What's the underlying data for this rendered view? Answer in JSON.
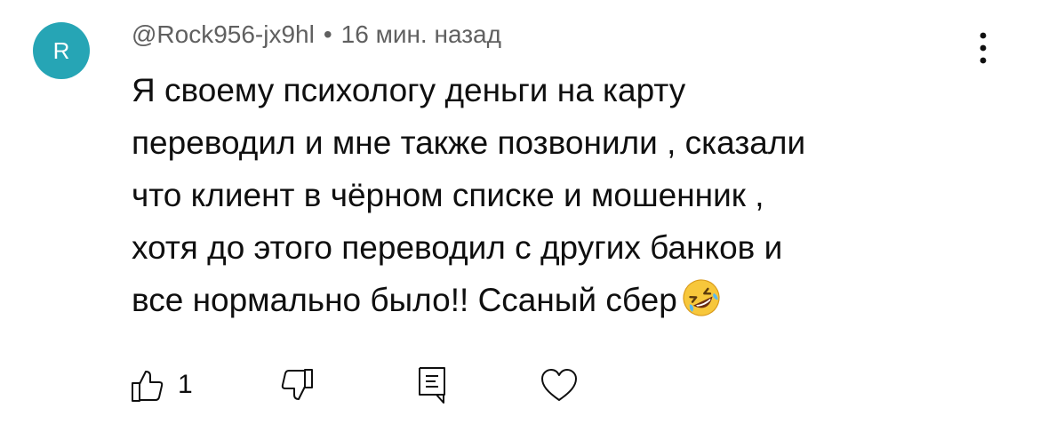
{
  "comment": {
    "avatar_letter": "R",
    "avatar_color": "#26a5b5",
    "author": "@Rock956-jx9hl",
    "separator": "•",
    "time": "16 мин. назад",
    "body": "Я своему психологу деньги на карту\nпереводил и мне также позвонили , сказали\nчто клиент в чёрном списке и мошенник ,\nхотя до этого переводил с других банков и\nвсе нормально было!! Ссаный сбер",
    "emoji": "rolling-on-the-floor-laughing",
    "like_count": "1"
  },
  "icons": {
    "menu": "more-vertical-icon",
    "like": "thumbs-up-icon",
    "dislike": "thumbs-down-icon",
    "reply": "reply-comment-icon",
    "heart": "heart-icon"
  }
}
